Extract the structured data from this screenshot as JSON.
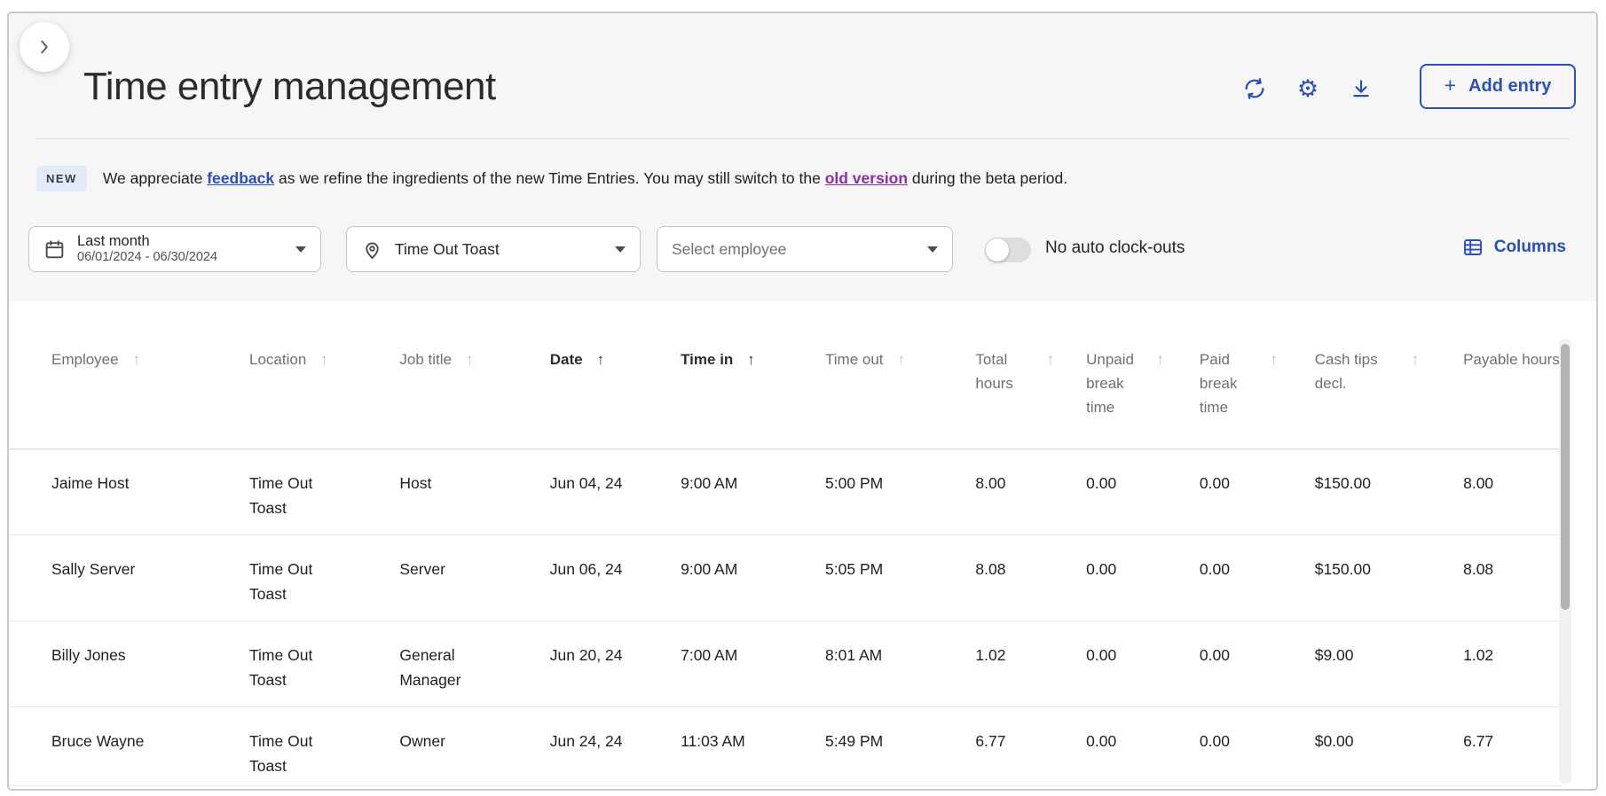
{
  "header": {
    "title": "Time entry management",
    "add_entry": {
      "plus": "+",
      "label": "Add entry"
    }
  },
  "banner": {
    "badge": "NEW",
    "pre": "We appreciate ",
    "feedback_link": "feedback",
    "mid": " as we refine the ingredients of the new Time Entries. You may still switch to the ",
    "old_version_link": "old version",
    "post": " during the beta period."
  },
  "filters": {
    "date": {
      "label": "Last month",
      "range": "06/01/2024 - 06/30/2024"
    },
    "location": {
      "value": "Time Out Toast"
    },
    "employee": {
      "placeholder": "Select employee"
    },
    "auto_clockouts_toggle": {
      "label": "No auto clock-outs",
      "state": "off"
    },
    "columns_button": "Columns"
  },
  "table": {
    "sort_arrow": "↑",
    "columns": [
      {
        "label": "Employee",
        "sorted": false
      },
      {
        "label": "Location",
        "sorted": false
      },
      {
        "label": "Job title",
        "sorted": false
      },
      {
        "label": "Date",
        "sorted": true
      },
      {
        "label": "Time in",
        "sorted": true
      },
      {
        "label": "Time out",
        "sorted": false
      },
      {
        "label": "Total hours",
        "sorted": false
      },
      {
        "label": "Unpaid break time",
        "sorted": false
      },
      {
        "label": "Paid break time",
        "sorted": false
      },
      {
        "label": "Cash tips decl.",
        "sorted": false
      },
      {
        "label": "Payable hours",
        "sorted": false,
        "clipped": true
      }
    ],
    "rows": [
      {
        "employee": "Jaime Host",
        "location": "Time Out Toast",
        "job_title": "Host",
        "date": "Jun 04, 24",
        "time_in": "9:00 AM",
        "time_out": "5:00 PM",
        "total_hours": "8.00",
        "unpaid_break_time": "0.00",
        "paid_break_time": "0.00",
        "cash_tips_decl": "$150.00",
        "payable_hours": "8.00"
      },
      {
        "employee": "Sally Server",
        "location": "Time Out Toast",
        "job_title": "Server",
        "date": "Jun 06, 24",
        "time_in": "9:00 AM",
        "time_out": "5:05 PM",
        "total_hours": "8.08",
        "unpaid_break_time": "0.00",
        "paid_break_time": "0.00",
        "cash_tips_decl": "$150.00",
        "payable_hours": "8.08"
      },
      {
        "employee": "Billy Jones",
        "location": "Time Out Toast",
        "job_title": "General Manager",
        "date": "Jun 20, 24",
        "time_in": "7:00 AM",
        "time_out": "8:01 AM",
        "total_hours": "1.02",
        "unpaid_break_time": "0.00",
        "paid_break_time": "0.00",
        "cash_tips_decl": "$9.00",
        "payable_hours": "1.02"
      },
      {
        "employee": "Bruce Wayne",
        "location": "Time Out Toast",
        "job_title": "Owner",
        "date": "Jun 24, 24",
        "time_in": "11:03 AM",
        "time_out": "5:49 PM",
        "total_hours": "6.77",
        "unpaid_break_time": "0.00",
        "paid_break_time": "0.00",
        "cash_tips_decl": "$0.00",
        "payable_hours": "6.77"
      }
    ]
  },
  "colors": {
    "accent_blue": "#2b4fb8",
    "link_purple": "#8d2fa6",
    "page_bg": "#f6f6f6",
    "badge_bg": "#e1ebf9"
  }
}
